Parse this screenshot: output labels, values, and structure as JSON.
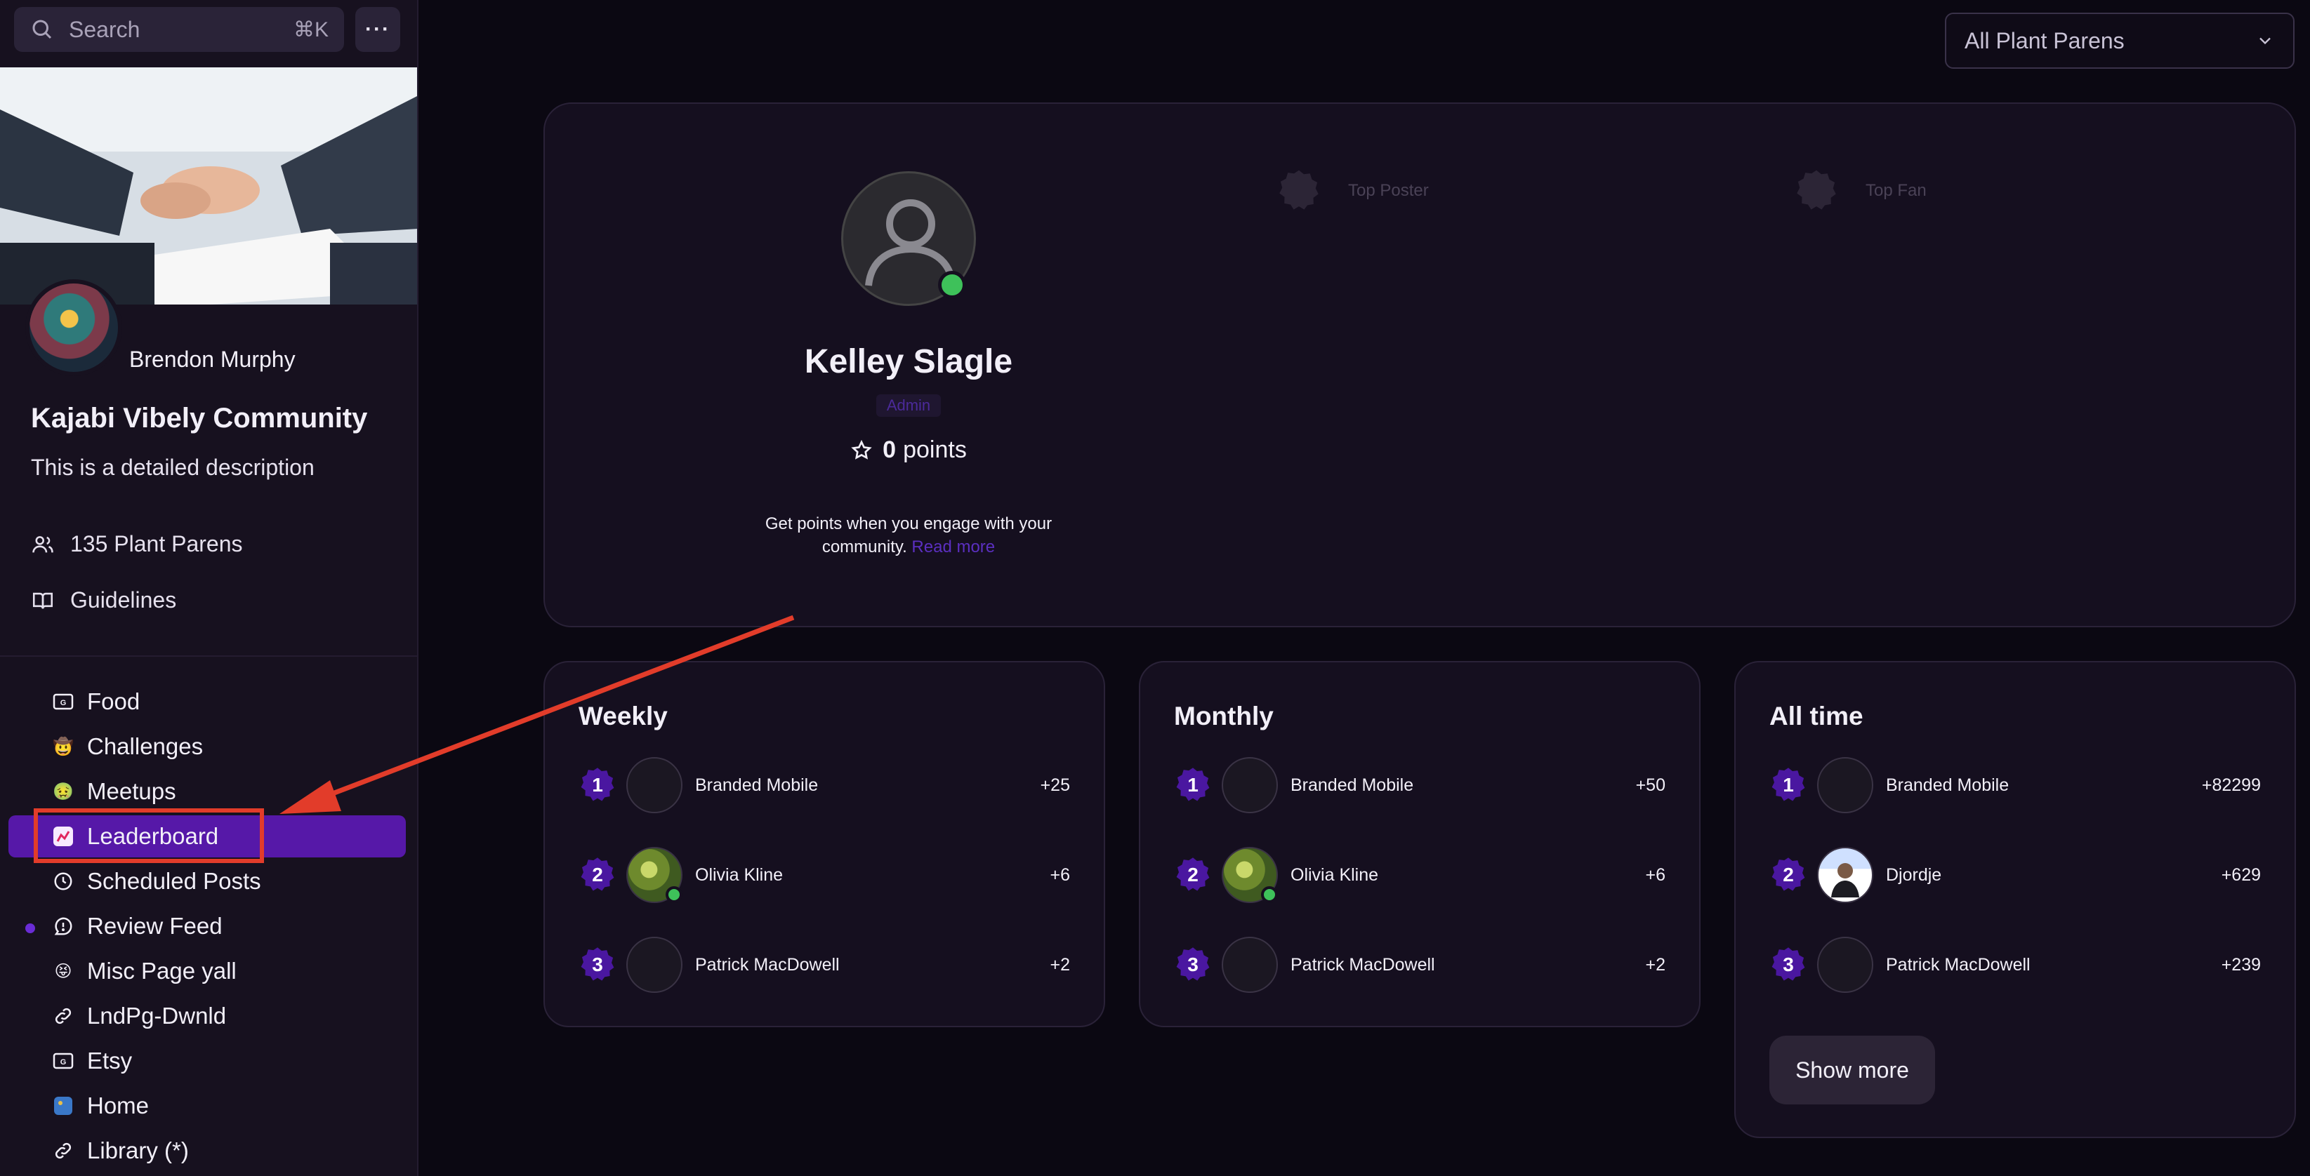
{
  "search": {
    "label": "Search",
    "shortcut": "⌘K"
  },
  "more_button": {
    "label": "···"
  },
  "community": {
    "owner_name": "Brendon Murphy",
    "name": "Kajabi Vibely Community",
    "description": "This is a detailed description",
    "members_label": "135 Plant Parens",
    "guidelines_label": "Guidelines"
  },
  "nav": {
    "items": [
      {
        "label": "Food",
        "icon": "calendar-badge-icon"
      },
      {
        "label": "Challenges",
        "icon": "emoji-cowboy-icon"
      },
      {
        "label": "Meetups",
        "icon": "emoji-nauseated-icon"
      },
      {
        "label": "Leaderboard",
        "icon": "chart-image-icon",
        "active": true
      },
      {
        "label": "Scheduled Posts",
        "icon": "clock-icon"
      },
      {
        "label": "Review Feed",
        "icon": "message-alert-icon",
        "has_dot": true
      },
      {
        "label": "Misc Page yall",
        "icon": "emoji-tongue-icon"
      },
      {
        "label": "LndPg-Dwnld",
        "icon": "link-icon"
      },
      {
        "label": "Etsy",
        "icon": "calendar-badge-icon"
      },
      {
        "label": "Home",
        "icon": "blue-square-icon"
      },
      {
        "label": "Library (*)",
        "icon": "link-icon"
      }
    ]
  },
  "filter": {
    "selected": "All Plant Parens"
  },
  "profile": {
    "name": "Kelley Slagle",
    "role": "Admin",
    "points_value": "0",
    "points_unit": "points",
    "help_text": "Get points when you engage with your community.",
    "read_more": "Read more",
    "awards": [
      "Top Poster",
      "Top Fan"
    ]
  },
  "boards": [
    {
      "title": "Weekly",
      "rows": [
        {
          "rank": "1",
          "name": "Branded Mobile",
          "score": "+25",
          "avatar": "blank"
        },
        {
          "rank": "2",
          "name": "Olivia Kline",
          "score": "+6",
          "avatar": "plant",
          "online": true
        },
        {
          "rank": "3",
          "name": "Patrick MacDowell",
          "score": "+2",
          "avatar": "blank"
        }
      ]
    },
    {
      "title": "Monthly",
      "rows": [
        {
          "rank": "1",
          "name": "Branded Mobile",
          "score": "+50",
          "avatar": "blank"
        },
        {
          "rank": "2",
          "name": "Olivia Kline",
          "score": "+6",
          "avatar": "plant",
          "online": true
        },
        {
          "rank": "3",
          "name": "Patrick MacDowell",
          "score": "+2",
          "avatar": "blank"
        }
      ]
    },
    {
      "title": "All time",
      "rows": [
        {
          "rank": "1",
          "name": "Branded Mobile",
          "score": "+82299",
          "avatar": "blank"
        },
        {
          "rank": "2",
          "name": "Djordje",
          "score": "+629",
          "avatar": "person"
        },
        {
          "rank": "3",
          "name": "Patrick MacDowell",
          "score": "+239",
          "avatar": "blank"
        }
      ],
      "show_more": "Show more"
    }
  ],
  "colors": {
    "accent": "#5618a8",
    "rank_badge": "#4a17a0",
    "annotation": "#e23c2a",
    "online": "#3ec15a"
  }
}
